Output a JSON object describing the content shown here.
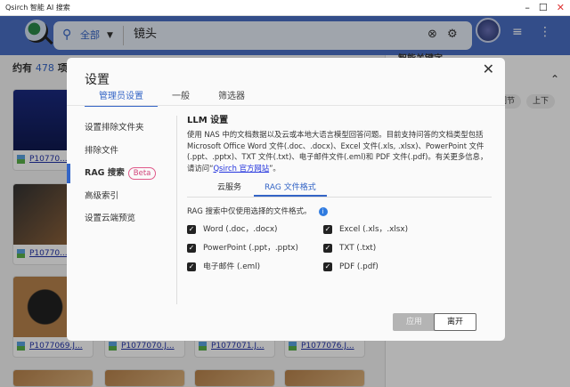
{
  "window": {
    "title": "Qsirch 智能 AI 搜索",
    "min": "–",
    "max": "☐",
    "close": "✕"
  },
  "search": {
    "scope": "全部",
    "query": "镜头"
  },
  "results": {
    "prefix": "约有",
    "count": "478",
    "suffix": "项结果"
  },
  "cards": [
    {
      "name": "P10770..."
    },
    {
      "name": "P10770..."
    },
    {
      "name": "P1077069.J..."
    },
    {
      "name": "P1077070.J..."
    },
    {
      "name": "P1077071.J..."
    },
    {
      "name": "P1077076.J..."
    }
  ],
  "right_panel": {
    "title": "智能关键字",
    "chips": [
      "调节",
      "上下"
    ]
  },
  "modal": {
    "title": "设置",
    "tabs": [
      "管理员设置",
      "一般",
      "筛选器"
    ],
    "nav": [
      "设置排除文件夹",
      "排除文件",
      "RAG 搜索",
      "高级索引",
      "设置云端预览"
    ],
    "beta": "Beta",
    "section_title": "LLM 设置",
    "description": "使用 NAS 中的文档数据以及云或本地大语言模型回答问题。目前支持问答的文档类型包括 Microsoft Office Word 文件(.doc、.docx)、Excel 文件(.xls, .xlsx)、PowerPoint 文件(.ppt、.pptx)、TXT 文件(.txt)、电子邮件文件(.eml)和 PDF 文件(.pdf)。有关更多信息，请访问“",
    "link": "Qsirch 官方网站",
    "desc_end": "”。",
    "subtabs": [
      "云服务",
      "RAG 文件格式"
    ],
    "note": "RAG 搜索中仅使用选择的文件格式。",
    "formats": [
      "Word (.doc，.docx)",
      "Excel (.xls，.xlsx)",
      "PowerPoint (.ppt，.pptx)",
      "TXT (.txt)",
      "电子邮件 (.eml)",
      "PDF (.pdf)"
    ],
    "apply": "应用",
    "leave": "离开"
  }
}
